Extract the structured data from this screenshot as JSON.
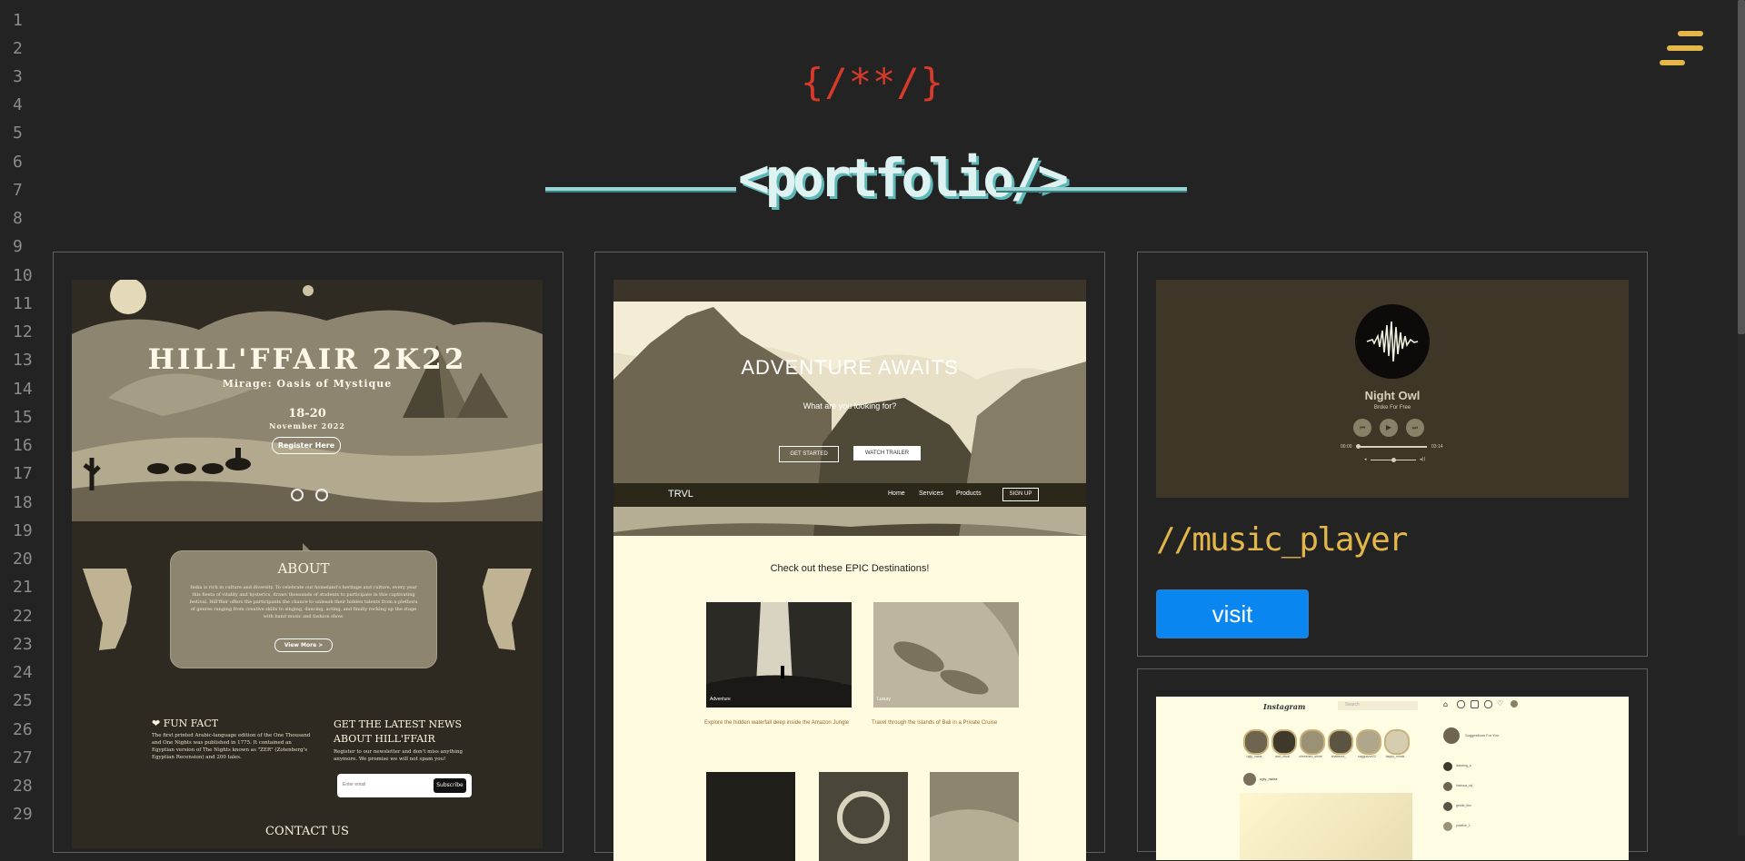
{
  "gutter": {
    "line_numbers": [
      "1",
      "2",
      "3",
      "4",
      "5",
      "6",
      "7",
      "8",
      "9",
      "10",
      "11",
      "12",
      "13",
      "14",
      "15",
      "16",
      "17",
      "18",
      "19",
      "20",
      "21",
      "22",
      "23",
      "24",
      "25",
      "26",
      "27",
      "28",
      "29"
    ]
  },
  "header": {
    "braces": "{/**/}",
    "portfolio_title": "<portfolio/>"
  },
  "menu": {
    "icon": "hamburger-menu-icon",
    "color": "#e3b64a"
  },
  "colors": {
    "background": "#232323",
    "accent": "#e3b64a",
    "visit_button": "#0a86f0",
    "braces": "#d83a2a"
  },
  "hillffair": {
    "title": "HILL'FFAIR 2K22",
    "subtitle": "Mirage: Oasis of Mystique",
    "dates": "18-20",
    "month": "November 2022",
    "register_button": "Register Here",
    "about_heading": "ABOUT",
    "about_text": "India is rich in culture and diversity. To celebrate our homeland's heritage and culture, every year this fiesta of vitality and hysterics, draws thousands of students to participate in this captivating festival. Hill'ffair offers the participants the chance to unleash their hidden talents from a plethora of genres ranging from creative skills to singing, dancing, acting, and finally rocking up the stage with band music and fashion show.",
    "view_more_button": "View More >",
    "fun_fact_heading": "FUN FACT",
    "fun_fact_text": "The first printed Arabic-language edition of the One Thousand and One Nights was published in 1775. It contained an Egyptian version of The Nights known as \"ZER\" (Zotenberg's Egyptian Recension) and 200 tales.",
    "news_heading_1": "GET THE LATEST NEWS",
    "news_heading_2": "ABOUT HILL'FFAIR",
    "news_text": "Register to our newsletter and don't miss anything anymore. We promise we will not spam you!",
    "email_placeholder": "Enter email",
    "subscribe_button": "Subscribe",
    "contact_heading": "CONTACT US"
  },
  "trvl": {
    "hero_title": "ADVENTURE AWAITS",
    "hero_subtitle": "What are you looking for?",
    "get_started": "GET STARTED",
    "watch_trailer": "WATCH TRAILER",
    "logo": "TRVL",
    "nav": [
      "Home",
      "Services",
      "Products"
    ],
    "sign_up": "SIGN UP",
    "section_heading": "Check out these EPIC Destinations!",
    "card1_label": "Adventure",
    "card1_text": "Explore the hidden waterfall deep inside the Amazon Jungle",
    "card2_label": "Luxury",
    "card2_text": "Travel through the Islands of Bali in a Private Cruise"
  },
  "music_player": {
    "song": "Night Owl",
    "artist": "Broke For Free",
    "time_current": "00:00",
    "time_total": "03:14",
    "progress": 0,
    "volume": 0.5,
    "section_title": "//music_player",
    "visit_button": "visit"
  },
  "instagram": {
    "logo": "Instagram",
    "search_placeholder": "Search",
    "stories": [
      "ugly_naina",
      "anvi_ritual",
      "cherished_shine",
      "shattered_",
      "saggulove22",
      "happy_minds"
    ],
    "suggest_heading": "Suggestions For You",
    "suggestions": [
      "dazzling_a",
      "lustrous_raj",
      "gentle_flux",
      "positive_1"
    ],
    "post_user": "ugly_naina"
  }
}
